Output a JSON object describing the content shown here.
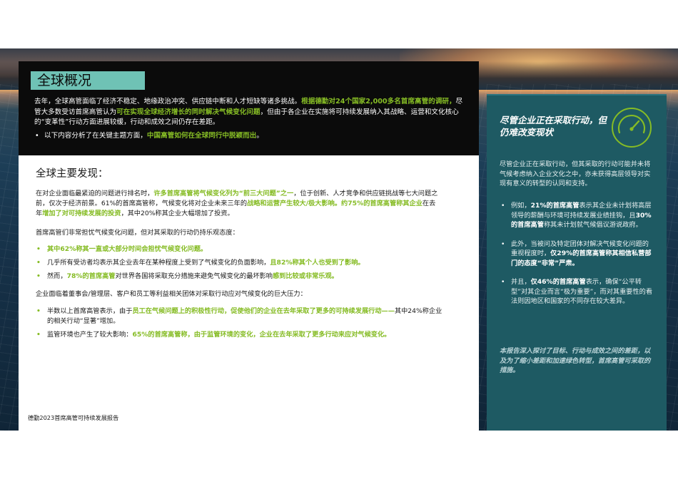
{
  "overview": {
    "title": "全球概况",
    "para_1": "去年，全球高管面临了经济不稳定、地缘政治冲突、供应链中断和人才短缺等诸多挑战。",
    "para_1_green": "根据德勤对24个国家2,000多名首席高管的调研，",
    "para_1_b": "尽管大多数受访首席高管认为",
    "para_1_green_2": "可在实现全球经济增长的同时解决气候变化问题",
    "para_1_c": "，但由于各企业在实施将可持续发展纳入其战略、运营和文化核心的“变革性”行动方面进展较缓，行动和成效之间仍存在差距。",
    "bullet_pre": "以下内容分析了在关键主题方面，",
    "bullet_green": "中国高管如何在全球同行中脱颖而出",
    "bullet_post": "。"
  },
  "findings": {
    "title": "全球主要发现：",
    "p1_a": "在对企业面临最紧迫的问题进行排名时，",
    "p1_green": "许多首席高管将气候变化列为“前三大问题”之一",
    "p1_b": "，位于创新、人才竞争和供应链挑战等七大问题之前，仅次于经济前景。61%的首席高管称，气候变化将对企业未来三年的",
    "p1_green_2": "战略和运营产生较大/极大影响。约75%的首席高管称其企业",
    "p1_c": "在去年",
    "p1_green_3": "增加了对可持续发展的投资",
    "p1_d": "，其中20%称其企业大幅增加了投资。",
    "p2": "首席高管们非常担忧气候变化问题，但对其采取的行动仍持乐观态度：",
    "list_1": [
      {
        "pre": "",
        "green": "其中62%称其一直或大部分时间会担忧气候变化问题。",
        "post": ""
      },
      {
        "pre": "几乎所有受访者均表示其企业去年在某种程度上受到了气候变化的负面影响，",
        "green": "且82%称其个人也受到了影响。",
        "post": ""
      },
      {
        "pre": "然而，",
        "green": "78%的首席高管",
        "post": "对世界各国将采取充分措施来避免气候变化的最坏影响",
        "green_2": "感到比较或非常乐观。"
      }
    ],
    "p3": "企业面临着董事会/管理层、客户和员工等利益相关团体对采取行动应对气候变化的巨大压力：",
    "list_2": [
      {
        "pre": "半数以上首席高管表示，由于",
        "green": "员工在气候问题上的积极性行动，促使他们的企业在去年采取了更多的可持续发展行动——",
        "post": "其中24%称企业的相关行动“显著”增加。"
      },
      {
        "pre": "监管环境也产生了较大影响：",
        "green": "65%的首席高管称，由于监管环境的变化，企业在去年采取了更多行动来应对气候变化。",
        "post": ""
      }
    ],
    "footer": "德勤2023首席高管可持续发展报告"
  },
  "sidebar": {
    "headline": "尽管企业正在采取行动，但仍难改变现状",
    "icon": "speedometer-gauge-icon",
    "intro": "尽管企业正在采取行动，但其采取的行动可能并未将气候考虑纳入企业文化之中，亦未获得高层领导对实现有意义的转型的认同和支持。",
    "items": [
      {
        "pre": "例如，",
        "b1": "21%的首席高管",
        "mid": "表示其企业未计划将高层领导的薪酬与环境可持续发展业绩挂钩，且",
        "b2": "30%的首席高管",
        "post": "称其未计划就气候倡议游说政府。"
      },
      {
        "pre": "此外，当被问及特定团体对解决气候变化问题的重视程度时，",
        "b1": "仅29%的首席高管称其相信私营部门的态度“非常”严肃。",
        "mid": "",
        "b2": "",
        "post": ""
      },
      {
        "pre": "并且，",
        "b1": "仅46%的首席高管",
        "mid": "表示，确保“公平转型”对其企业而言“极为重要”，而对其重要性的看法则因地区和国家的不同存在较大差异。",
        "b2": "",
        "post": ""
      }
    ],
    "closing": "本报告深入探讨了目标、行动与成效之间的差距，以及为了缩小差距和加速绿色转型，首席高管可采取的措施。"
  },
  "colors": {
    "accent_green": "#86bc25",
    "teal_title_bg": "#6fc2b5",
    "sidebar_bg": "#1e5a63"
  }
}
